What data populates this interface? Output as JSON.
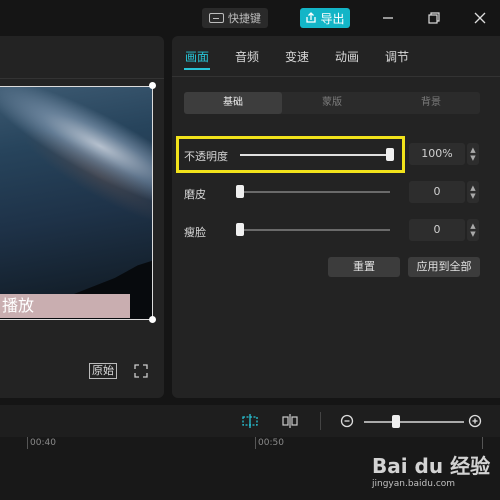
{
  "titlebar": {
    "shortcut_label": "快捷键",
    "export_label": "导出"
  },
  "preview": {
    "subtitle_text": "播放",
    "original_label": "原始"
  },
  "tabs": [
    "画面",
    "音频",
    "变速",
    "动画",
    "调节"
  ],
  "active_tab": "画面",
  "segments": [
    "基础",
    "蒙版",
    "背景"
  ],
  "active_segment": "基础",
  "properties": {
    "opacity": {
      "label": "不透明度",
      "value": "100%",
      "level": 1.0
    },
    "smoothing": {
      "label": "磨皮",
      "value": "0",
      "level": 0
    },
    "face_slim": {
      "label": "瘦脸",
      "value": "0",
      "level": 0
    }
  },
  "buttons": {
    "reset": "重置",
    "apply_all": "应用到全部"
  },
  "timeline": {
    "marks": [
      "00:40",
      "00:50"
    ]
  },
  "watermark": {
    "logo_text": "Bai du 经验",
    "url_text": "jingyan.baidu.com"
  },
  "colors": {
    "accent": "#28c4d6",
    "export_button": "#13b5c7",
    "highlight": "#f2e31b"
  }
}
